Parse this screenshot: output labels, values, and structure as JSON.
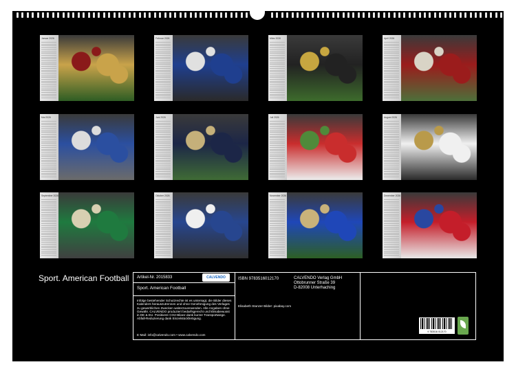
{
  "calendar": {
    "title": "Sport. American Football",
    "months": [
      {
        "name": "Januar 2026",
        "photo": "photo-linemen-scrum"
      },
      {
        "name": "Februar 2026",
        "photo": "photo-blue-tackle"
      },
      {
        "name": "März 2026",
        "photo": "photo-player-86"
      },
      {
        "name": "April 2026",
        "photo": "photo-red-white-pileup"
      },
      {
        "name": "Mai 2026",
        "photo": "photo-blue-linemen"
      },
      {
        "name": "Juni 2026",
        "photo": "photo-navy-33"
      },
      {
        "name": "Juli 2026",
        "photo": "photo-kickoff"
      },
      {
        "name": "August 2026",
        "photo": "photo-runner-8"
      },
      {
        "name": "September 2026",
        "photo": "photo-green-gold-run"
      },
      {
        "name": "Oktober 2026",
        "photo": "photo-quarterback"
      },
      {
        "name": "November 2026",
        "photo": "photo-blue-tackle-2"
      },
      {
        "name": "Dezember 2026",
        "photo": "photo-red-blue-pileup"
      }
    ],
    "info": {
      "article_label": "Artikel-Nr. 2015833",
      "publisher_logo": "CALVENDO",
      "product_title": "Sport. American Football",
      "legal_text": "Infolge bestehender Schutzrechte ist es untersagt, die Bilder dieses Kalenders herauszutrennen und ohne Genehmigung des Verlages zu gewerblichen Zwecken weiterzuverwenden. Alle Angaben ohne Gewähr. CALVENDO produziert bedarfsgerecht und klimabewusst in DE & EU. Positivere CO2-Bilanz dank kurzer Transportwege. Abfall-Reduzierung dank Einzelstückfertigung.",
      "contact": "E-Mail: info@calvendo.com • www.calvendo.com",
      "isbn": "ISBN 9783516012170",
      "credits": "Elisabeth Stanzer Bilder: pixabay.com",
      "publisher_lines": [
        "CALVENDO Verlag GmbH",
        "Ottobrunner Straße 39",
        "D-82008 Unterhaching"
      ],
      "barcode_number": "9 783516 012170"
    },
    "colors": {
      "background": "#000000",
      "text": "#ffffff",
      "eco_badge": "#6aa84f"
    }
  }
}
